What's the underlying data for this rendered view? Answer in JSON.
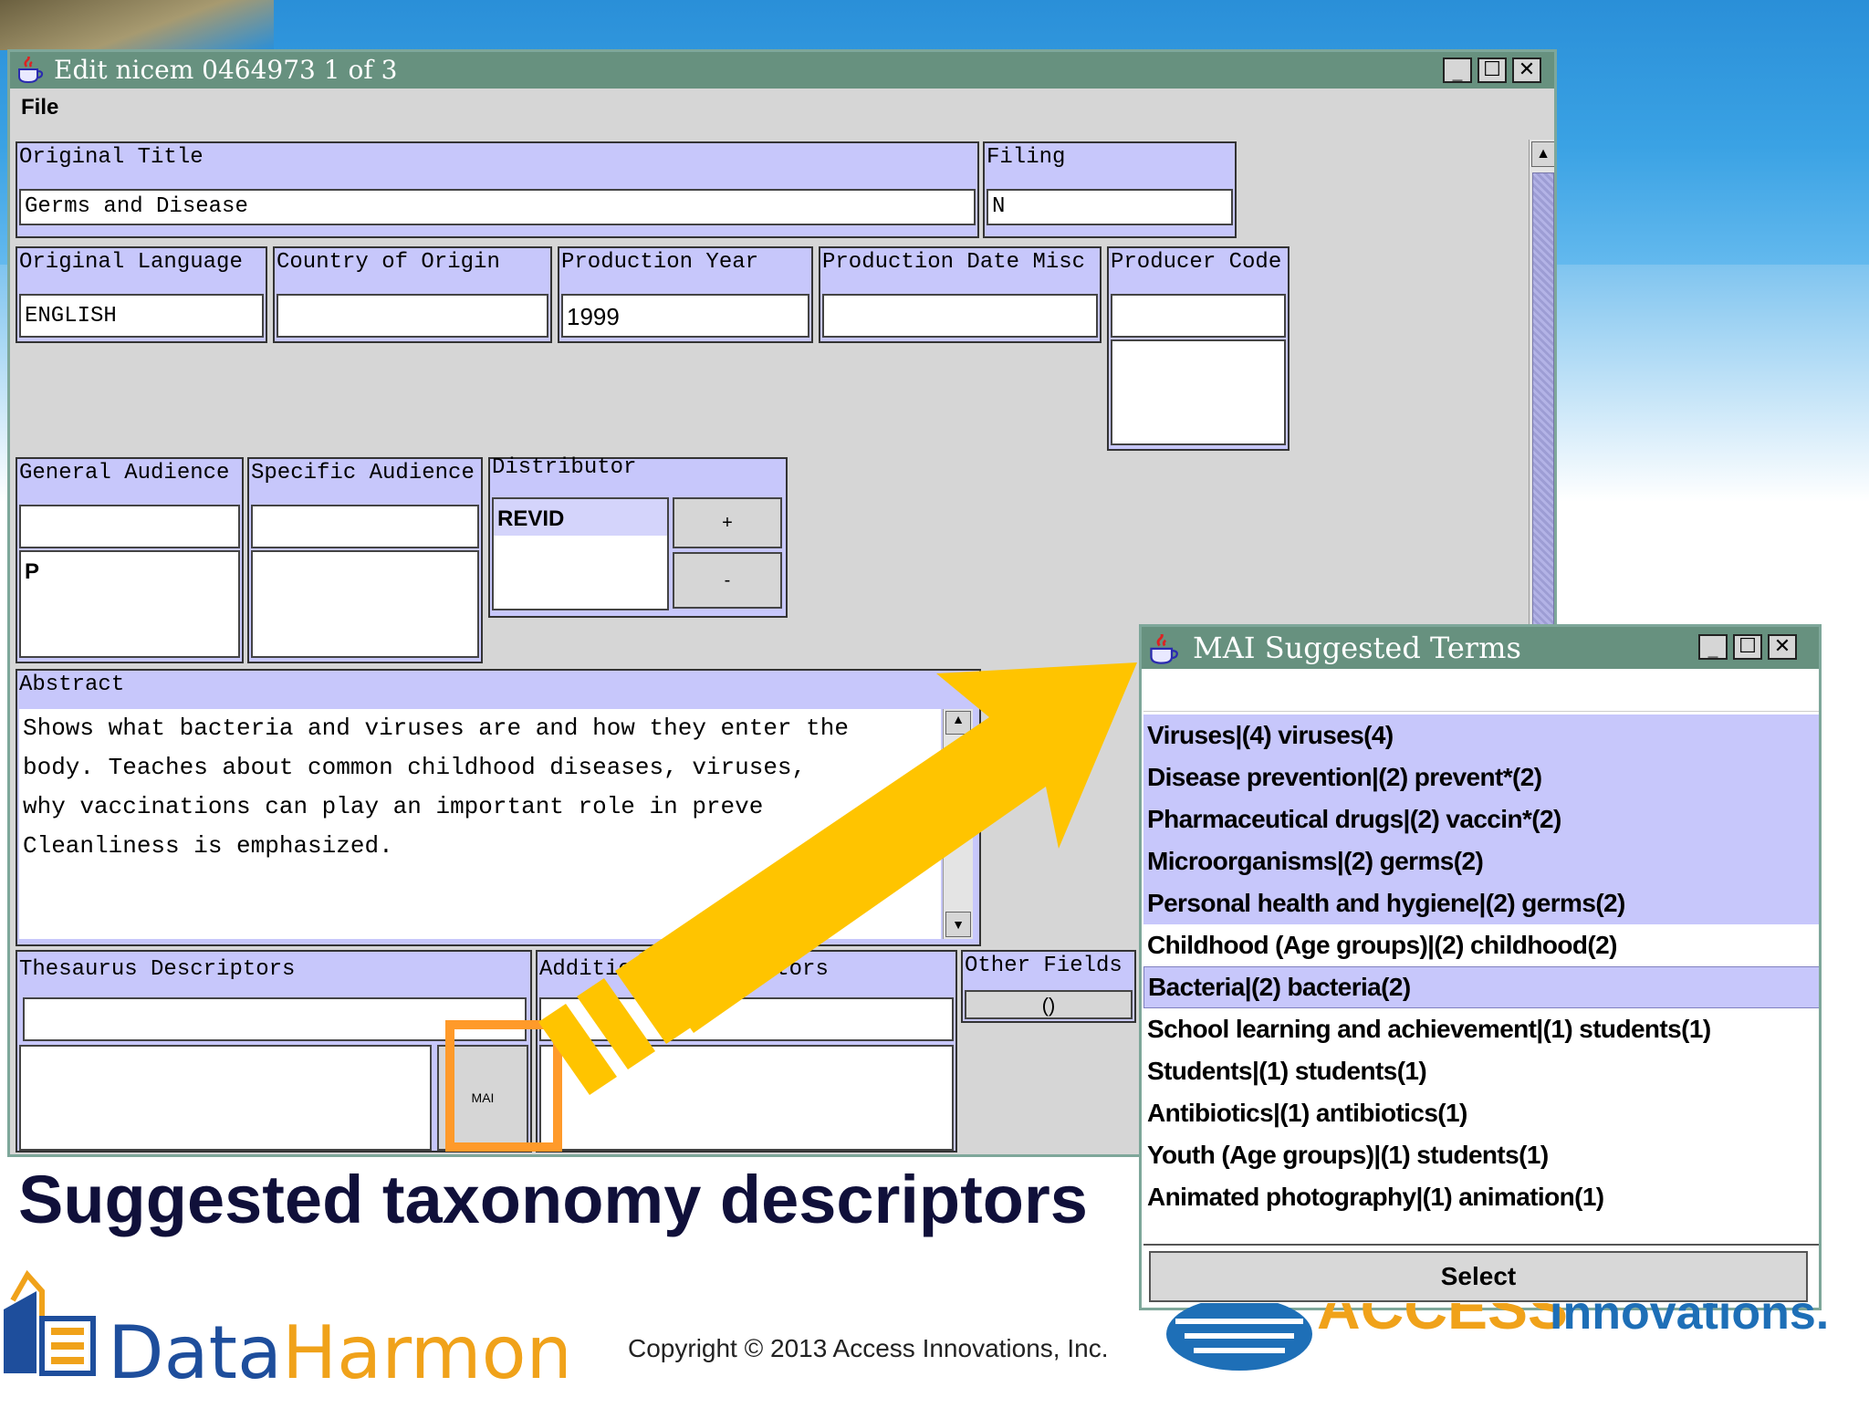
{
  "slide": {
    "caption": "Suggested taxonomy descriptors",
    "copyright": "Copyright © 2013 Access Innovations, Inc.",
    "logo_left": {
      "data": "Data",
      "harmony": "Harmony"
    },
    "logo_right": "Access Innovations"
  },
  "main_window": {
    "title": "Edit nicem 0464973 1 of 3",
    "menu": [
      "File"
    ],
    "fields": {
      "original_title": {
        "label": "Original Title",
        "value": "Germs and Disease"
      },
      "filing": {
        "label": "Filing",
        "value": "N"
      },
      "original_language": {
        "label": "Original Language",
        "value": "ENGLISH"
      },
      "country_of_origin": {
        "label": "Country of Origin",
        "value": ""
      },
      "production_year": {
        "label": "Production Year",
        "value": "1999"
      },
      "production_date_misc": {
        "label": "Production Date Misc",
        "value": ""
      },
      "producer_code": {
        "label": "Producer Code",
        "value": ""
      },
      "general_audience": {
        "label": "General Audience",
        "value": "",
        "list_value": "P"
      },
      "specific_audience": {
        "label": "Specific Audience",
        "value": ""
      },
      "distributor": {
        "label": "Distributor",
        "value": "REVID",
        "add_label": "+",
        "remove_label": "-"
      },
      "abstract": {
        "label": "Abstract",
        "lines": [
          "Shows what bacteria and viruses are and how they enter the",
          "body. Teaches about common childhood diseases, viruses,",
          "why vaccinations can play an important role in preve",
          "Cleanliness is emphasized."
        ]
      },
      "thesaurus_descriptors": {
        "label": "Thesaurus Descriptors",
        "mai_button": "MAI"
      },
      "additional_descriptors": {
        "label": "Additional Descriptors"
      },
      "other_fields": {
        "label": "Other Fields",
        "button": "()"
      }
    }
  },
  "mai_dialog": {
    "title": "MAI Suggested Terms",
    "terms": [
      {
        "text": "Viruses|(4) viruses(4)",
        "state": "hl"
      },
      {
        "text": "Disease prevention|(2) prevent*(2)",
        "state": "hl"
      },
      {
        "text": "Pharmaceutical drugs|(2) vaccin*(2)",
        "state": "hl"
      },
      {
        "text": "Microorganisms|(2) germs(2)",
        "state": "hl"
      },
      {
        "text": "Personal health and hygiene|(2) germs(2)",
        "state": "hl"
      },
      {
        "text": "Childhood (Age groups)|(2) childhood(2)",
        "state": "none"
      },
      {
        "text": "Bacteria|(2) bacteria(2)",
        "state": "sel"
      },
      {
        "text": "School learning and achievement|(1) students(1)",
        "state": "none"
      },
      {
        "text": "Students|(1) students(1)",
        "state": "none"
      },
      {
        "text": "Antibiotics|(1) antibiotics(1)",
        "state": "none"
      },
      {
        "text": "Youth (Age groups)|(1) students(1)",
        "state": "none"
      },
      {
        "text": "Animated photography|(1) animation(1)",
        "state": "none"
      }
    ],
    "select_label": "Select"
  },
  "colors": {
    "label_bg": "#c7c7fb",
    "titlebar": "#67917f",
    "arrow": "#ffc400",
    "highlight_box": "#ff9a2a"
  },
  "icons": [
    "java-coffee-icon",
    "minimize-icon",
    "maximize-icon",
    "close-icon",
    "scroll-up-icon",
    "scroll-down-icon",
    "arrow-annotation"
  ]
}
